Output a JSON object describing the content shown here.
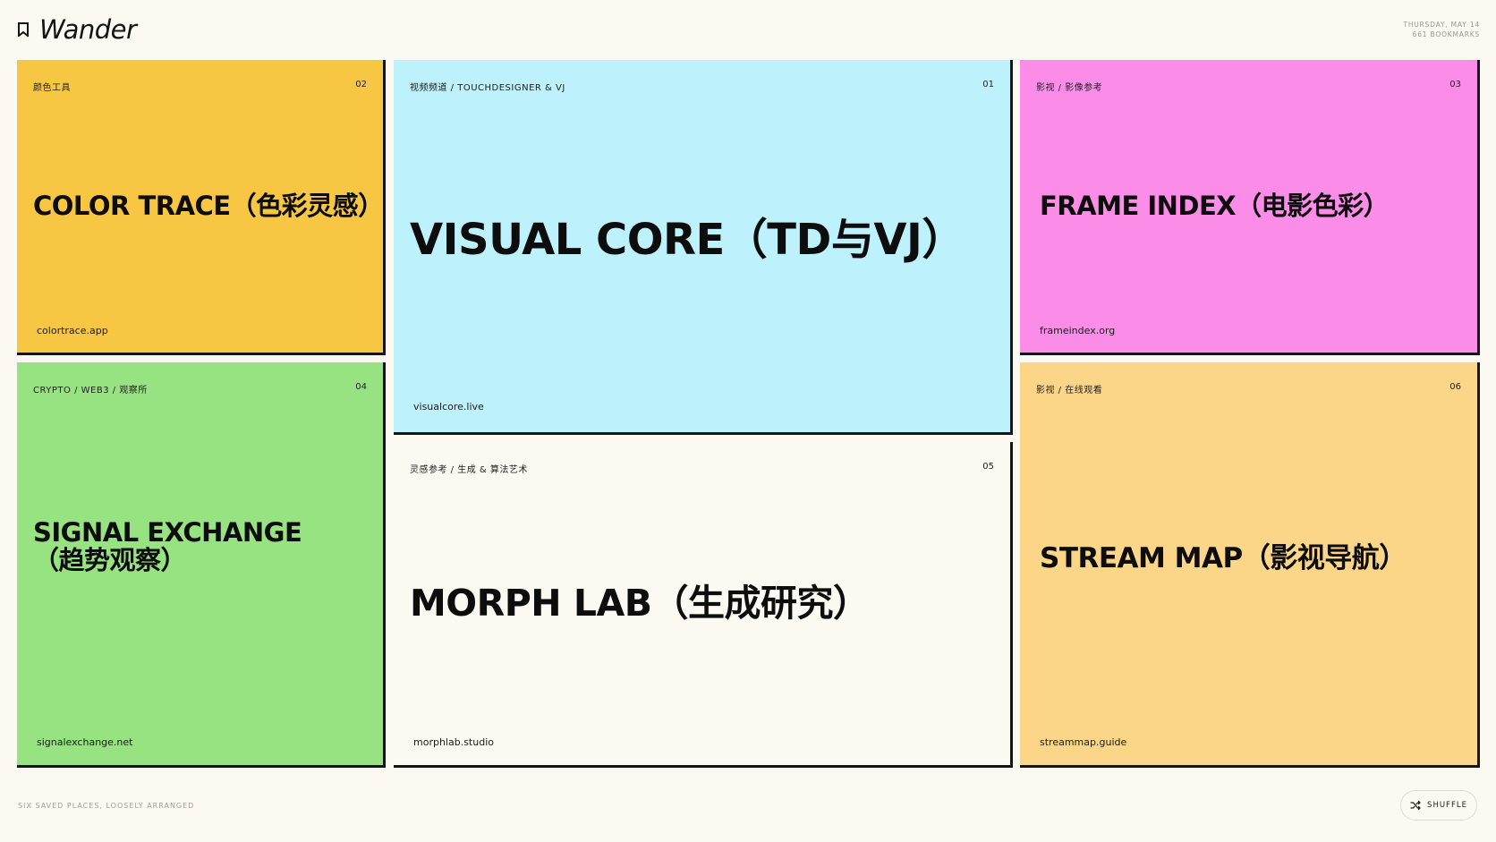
{
  "app": {
    "name": "Wander",
    "date": "THURSDAY, MAY 14",
    "bookmark_count": "661 BOOKMARKS"
  },
  "cards": [
    {
      "category": "颜色工具",
      "number": "02",
      "title": "COLOR TRACE（色彩灵感）",
      "domain": "colortrace.app",
      "color": "#f7c744"
    },
    {
      "category": "视频频道 / TOUCHDESIGNER & VJ",
      "number": "01",
      "title": "VISUAL CORE（TD与VJ）",
      "domain": "visualcore.live",
      "color": "#bdf1fb"
    },
    {
      "category": "影视 / 影像参考",
      "number": "03",
      "title": "FRAME INDEX（电影色彩）",
      "domain": "frameindex.org",
      "color": "#fb8ce8"
    },
    {
      "category": "CRYPTO / WEB3 / 观察所",
      "number": "04",
      "title": "SIGNAL EXCHANGE（趋势观察）",
      "domain": "signalexchange.net",
      "color": "#97e281"
    },
    {
      "category": "灵感参考 / 生成 & 算法艺术",
      "number": "05",
      "title": "MORPH LAB（生成研究）",
      "domain": "morphlab.studio",
      "color": "#fcf9f2"
    },
    {
      "category": "影视 / 在线观看",
      "number": "06",
      "title": "STREAM MAP（影视导航）",
      "domain": "streammap.guide",
      "color": "#fbd689"
    }
  ],
  "footer": {
    "note": "SIX SAVED PLACES, LOOSELY ARRANGED",
    "shuffle_label": "SHUFFLE"
  },
  "icons": {
    "brand": "bookmark-icon",
    "shuffle": "shuffle-icon"
  }
}
